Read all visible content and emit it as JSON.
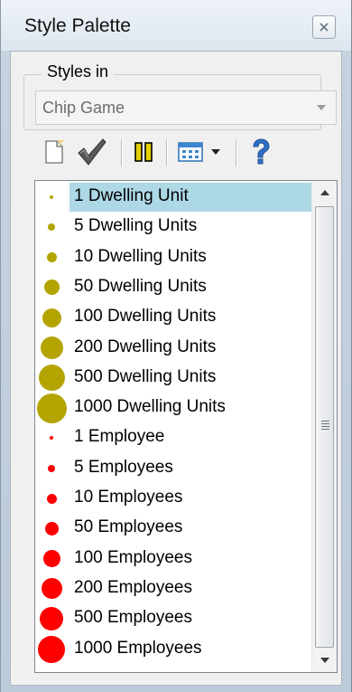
{
  "window": {
    "title": "Style Palette"
  },
  "styles_group": {
    "label": "Styles in",
    "selected": "Chip Game"
  },
  "toolbar": {
    "buttons": [
      "new-style-icon",
      "apply-check-icon",
      "columns-icon",
      "view-options-icon",
      "help-icon"
    ]
  },
  "styles": [
    {
      "label": "1 Dwelling Unit",
      "color": "#b3a400",
      "size": 4,
      "selected": true
    },
    {
      "label": "5 Dwelling Units",
      "color": "#b3a400",
      "size": 8
    },
    {
      "label": "10 Dwelling Units",
      "color": "#b3a400",
      "size": 11
    },
    {
      "label": "50 Dwelling Units",
      "color": "#b3a400",
      "size": 17
    },
    {
      "label": "100 Dwelling Units",
      "color": "#b3a400",
      "size": 21
    },
    {
      "label": "200 Dwelling Units",
      "color": "#b3a400",
      "size": 25
    },
    {
      "label": "500 Dwelling Units",
      "color": "#b3a400",
      "size": 29
    },
    {
      "label": "1000 Dwelling Units",
      "color": "#b3a400",
      "size": 33
    },
    {
      "label": "1 Employee",
      "color": "#ff0000",
      "size": 4
    },
    {
      "label": "5 Employees",
      "color": "#ff0000",
      "size": 8
    },
    {
      "label": "10 Employees",
      "color": "#ff0000",
      "size": 11
    },
    {
      "label": "50 Employees",
      "color": "#ff0000",
      "size": 15
    },
    {
      "label": "100 Employees",
      "color": "#ff0000",
      "size": 19
    },
    {
      "label": "200 Employees",
      "color": "#ff0000",
      "size": 23
    },
    {
      "label": "500 Employees",
      "color": "#ff0000",
      "size": 26
    },
    {
      "label": "1000 Employees",
      "color": "#ff0000",
      "size": 30
    }
  ]
}
